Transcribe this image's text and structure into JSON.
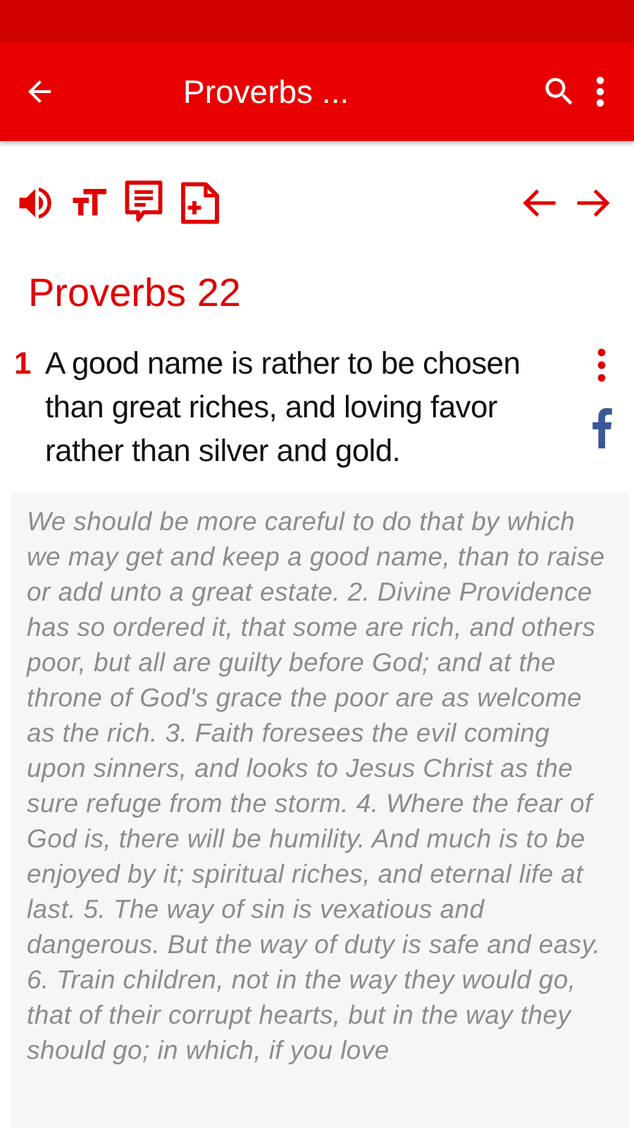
{
  "app_bar": {
    "title": "Proverbs ..."
  },
  "chapter": {
    "heading": "Proverbs 22"
  },
  "verse": {
    "number": "1",
    "text": "A good name is rather to be chosen than great riches, and loving favor rather than silver and gold."
  },
  "commentary": {
    "text": "We should be more careful to do that by which we may get and keep a good name, than to raise or add unto a great estate. 2. Divine Providence has so ordered it, that some are rich, and others poor, but all are guilty before God; and at the throne of God's grace the poor are as welcome as the rich. 3. Faith foresees the evil coming upon sinners, and looks to Jesus Christ as the sure refuge from the storm. 4. Where the fear of God is, there will be humility. And much is to be enjoyed by it; spiritual riches, and eternal life at last. 5. The way of sin is vexatious and dangerous. But the way of duty is safe and easy. 6. Train children, not in the way they would go, that of their corrupt hearts, but in the way they should go; in which, if you love"
  }
}
